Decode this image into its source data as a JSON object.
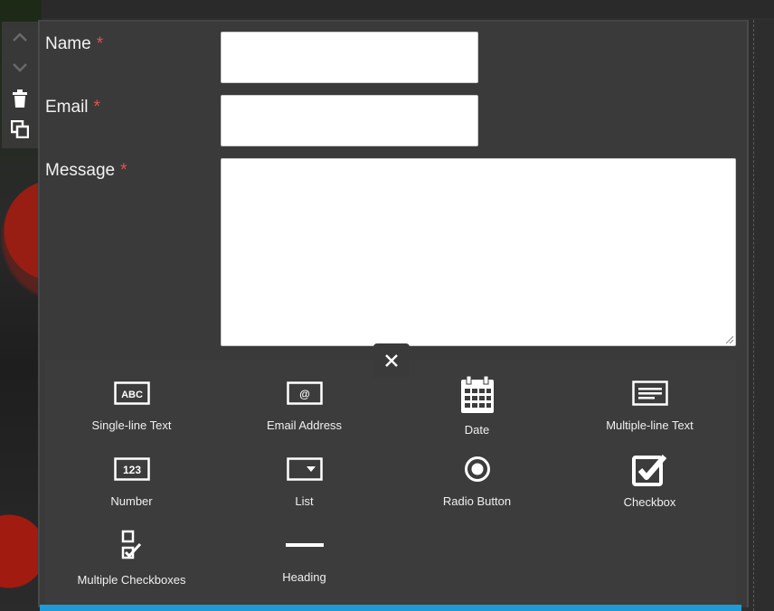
{
  "form": {
    "fields": [
      {
        "label": "Name",
        "required_mark": "*",
        "type": "single-line",
        "value": ""
      },
      {
        "label": "Email",
        "required_mark": "*",
        "type": "single-line",
        "value": ""
      },
      {
        "label": "Message",
        "required_mark": "*",
        "type": "multi-line",
        "value": ""
      }
    ]
  },
  "palette": {
    "items": [
      {
        "label": "Single-line Text",
        "icon": "text-field-abc-icon",
        "icon_text": "ABC"
      },
      {
        "label": "Email Address",
        "icon": "email-field-at-icon",
        "icon_text": "@"
      },
      {
        "label": "Date",
        "icon": "calendar-icon"
      },
      {
        "label": "Multiple-line Text",
        "icon": "textarea-icon"
      },
      {
        "label": "Number",
        "icon": "number-field-123-icon",
        "icon_text": "123"
      },
      {
        "label": "List",
        "icon": "dropdown-list-icon"
      },
      {
        "label": "Radio Button",
        "icon": "radio-button-icon"
      },
      {
        "label": "Checkbox",
        "icon": "checkbox-icon"
      },
      {
        "label": "Multiple Checkboxes",
        "icon": "multiple-checkboxes-icon"
      },
      {
        "label": "Heading",
        "icon": "heading-line-icon"
      }
    ]
  },
  "toolbar": [
    "chevron-up-icon",
    "chevron-down-icon",
    "trash-icon",
    "duplicate-icon"
  ],
  "colors": {
    "panel_bg": "#3a3a3a",
    "required": "#e0524a",
    "accent_bar": "#1f9ad6",
    "text": "#f2f2f2"
  }
}
